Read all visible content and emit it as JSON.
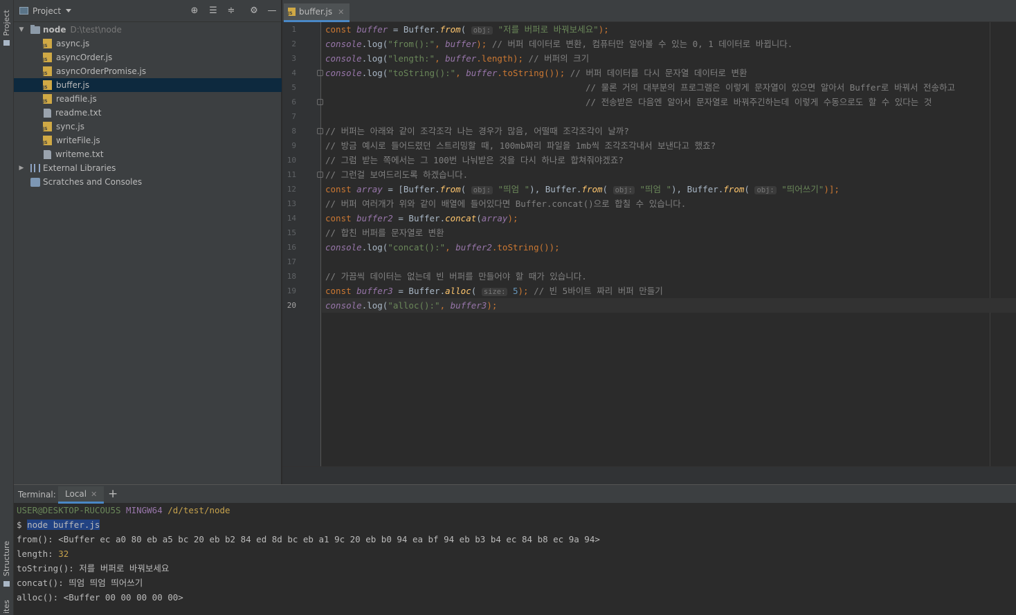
{
  "sidebar_strip": {
    "project_label": "Project",
    "structure_label": "Structure",
    "favorites_label": "ites"
  },
  "project_panel": {
    "title": "Project",
    "tree": {
      "root_name": "node",
      "root_path": "D:\\test\\node",
      "files": [
        "async.js",
        "asyncOrder.js",
        "asyncOrderPromise.js",
        "buffer.js",
        "readfile.js",
        "readme.txt",
        "sync.js",
        "writeFile.js",
        "writeme.txt"
      ],
      "selected_file": "buffer.js",
      "external_libraries": "External Libraries",
      "scratches": "Scratches and Consoles"
    }
  },
  "editor": {
    "tab_label": "buffer.js",
    "current_line": 20,
    "line_numbers": [
      "1",
      "2",
      "3",
      "4",
      "5",
      "6",
      "7",
      "8",
      "9",
      "10",
      "11",
      "12",
      "13",
      "14",
      "15",
      "16",
      "17",
      "18",
      "19",
      "20"
    ],
    "code": {
      "l1": {
        "kw": "const ",
        "var": "buffer",
        "a": " = Buffer.",
        "fn": "from",
        "b": "(",
        "hint": "obj:",
        "str": "\"저를 버퍼로 바꿔보세요\"",
        "c": ");"
      },
      "l2": {
        "var": "console",
        "a": ".log(",
        "str": "\"from():\"",
        "b": ", ",
        "var2": "buffer",
        "c": "); ",
        "cm": "// 버퍼 데이터로 변환, 컴퓨터만 알아볼 수 있는 0, 1 데이터로 바뀝니다."
      },
      "l3": {
        "var": "console",
        "a": ".log(",
        "str": "\"length:\"",
        "b": ", ",
        "var2": "buffer",
        "c": ".length); ",
        "cm": "// 버퍼의 크기"
      },
      "l4": {
        "var": "console",
        "a": ".log(",
        "str": "\"toString():\"",
        "b": ", ",
        "var2": "buffer",
        "c": ".toString()); ",
        "cm": "// 버퍼 데이터를 다시 문자열 데이터로 변환"
      },
      "l5": {
        "cm": "// 물론 거의 대부분의 프로그램은 이렇게 문자열이 있으면 알아서 Buffer로 바꿔서 전송하고"
      },
      "l6": {
        "cm": "// 전송받은 다음엔 알아서 문자열로 바꿔주긴하는데 이렇게 수동으로도 할 수 있다는 것"
      },
      "l8": {
        "cm": "// 버퍼는 아래와 같이 조각조각 나는 경우가 많음, 어떨때 조각조각이 날까?"
      },
      "l9": {
        "cm": "// 방금 예시로 들어드렸던 스트리밍할 때, 100mb짜리 파일을 1mb씩 조각조각내서 보낸다고 했죠?"
      },
      "l10": {
        "cm": "// 그럼 받는 쪽에서는 그 100번 나눠받은 것을 다시 하나로 합쳐줘야겠죠?"
      },
      "l11": {
        "cm": "// 그런걸 보여드리도록 하겠습니다."
      },
      "l12": {
        "kw": "const ",
        "var": "array",
        "a": " = [Buffer.",
        "fn": "from",
        "b": "(",
        "hint": "obj:",
        "str": "\"띄엄 \"",
        "c": "), Buffer.",
        "fn2": "from",
        "d": "(",
        "hint2": "obj:",
        "str2": "\"띄엄 \"",
        "e": "), Buffer.",
        "fn3": "from",
        "f": "(",
        "hint3": "obj:",
        "str3": "\"띄어쓰기\"",
        "g": ")];"
      },
      "l13": {
        "cm": "// 버퍼 여러개가 위와 같이 배열에 들어있다면 Buffer.concat()으로 합칠 수 있습니다."
      },
      "l14": {
        "kw": "const ",
        "var": "buffer2",
        "a": " = Buffer.",
        "fn": "concat",
        "b": "(",
        "var2": "array",
        "c": ");"
      },
      "l15": {
        "cm": "// 합친 버퍼를 문자열로 변환"
      },
      "l16": {
        "var": "console",
        "a": ".log(",
        "str": "\"concat():\"",
        "b": ", ",
        "var2": "buffer2",
        "c": ".toString());"
      },
      "l18": {
        "cm": "// 가끔씩 데이터는 없는데 빈 버퍼를 만들어야 할 때가 있습니다."
      },
      "l19": {
        "kw": "const ",
        "var": "buffer3",
        "a": " = Buffer.",
        "fn": "alloc",
        "b": "(",
        "hint": "size:",
        "num": "5",
        "c": "); ",
        "cm": "// 빈 5바이트 짜리 버퍼 만들기"
      },
      "l20": {
        "var": "console",
        "a": ".log(",
        "str": "\"alloc():\"",
        "b": ", ",
        "var2": "buffer3",
        "c": ");"
      }
    }
  },
  "terminal": {
    "title": "Terminal:",
    "tab_label": "Local",
    "add_label": "+",
    "prompt_user": "USER@DESKTOP-RUCOU5S",
    "prompt_env": "MINGW64",
    "prompt_path": "/d/test/node",
    "prompt_symbol": "$",
    "command": "node buffer.js",
    "out_from": "from(): <Buffer ec a0 80 eb a5 bc 20 eb b2 84 ed 8d bc eb a1 9c 20 eb b0 94 ea bf 94 eb b3 b4 ec 84 b8 ec 9a 94>",
    "out_length_label": "length: ",
    "out_length_value": "32",
    "out_tostring": "toString(): 저를 버퍼로 바꿔보세요",
    "out_concat": "concat(): 띄엄 띄엄 띄어쓰기",
    "out_alloc": "alloc(): <Buffer 00 00 00 00 00>"
  },
  "colors": {
    "keyword": "#cc7832",
    "variable": "#9876aa",
    "function": "#ffc66d",
    "string": "#6a8759",
    "comment": "#808080",
    "selection": "#0d293e",
    "accent": "#4a88c7"
  }
}
